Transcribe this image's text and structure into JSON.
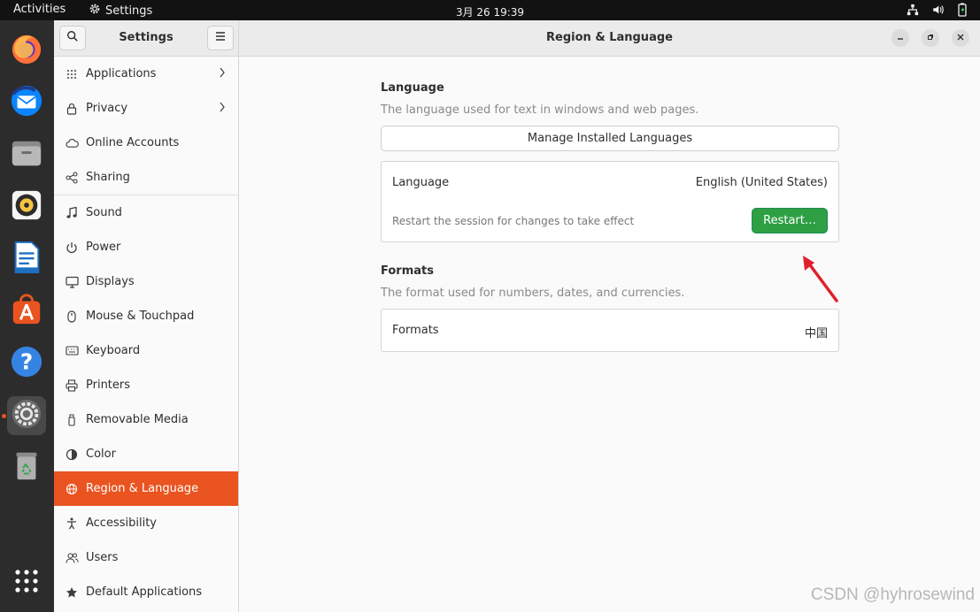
{
  "topbar": {
    "activities": "Activities",
    "app_name": "Settings",
    "clock": "3月 26  19:39"
  },
  "dock": {
    "items": [
      {
        "name": "firefox-icon"
      },
      {
        "name": "thunderbird-icon"
      },
      {
        "name": "files-icon"
      },
      {
        "name": "rhythmbox-icon"
      },
      {
        "name": "libreoffice-writer-icon"
      },
      {
        "name": "app-center-icon"
      },
      {
        "name": "help-icon"
      },
      {
        "name": "settings-icon",
        "active": true
      },
      {
        "name": "trash-icon"
      },
      {
        "name": "show-apps-icon"
      }
    ]
  },
  "sidebar": {
    "title": "Settings",
    "items": [
      {
        "label": "Applications",
        "icon": "apps-grid-icon",
        "chevron": true
      },
      {
        "label": "Privacy",
        "icon": "lock-icon",
        "chevron": true
      },
      {
        "label": "Online Accounts",
        "icon": "cloud-icon"
      },
      {
        "label": "Sharing",
        "icon": "share-icon"
      },
      {
        "label": "Sound",
        "icon": "music-note-icon"
      },
      {
        "label": "Power",
        "icon": "power-icon"
      },
      {
        "label": "Displays",
        "icon": "display-icon"
      },
      {
        "label": "Mouse & Touchpad",
        "icon": "mouse-icon"
      },
      {
        "label": "Keyboard",
        "icon": "keyboard-icon"
      },
      {
        "label": "Printers",
        "icon": "printer-icon"
      },
      {
        "label": "Removable Media",
        "icon": "usb-icon"
      },
      {
        "label": "Color",
        "icon": "color-icon"
      },
      {
        "label": "Region & Language",
        "icon": "globe-icon",
        "selected": true
      },
      {
        "label": "Accessibility",
        "icon": "accessibility-icon"
      },
      {
        "label": "Users",
        "icon": "users-icon"
      },
      {
        "label": "Default Applications",
        "icon": "star-icon"
      }
    ]
  },
  "main": {
    "title": "Region & Language",
    "language_section": {
      "title": "Language",
      "subtitle": "The language used for text in windows and web pages.",
      "manage_button": "Manage Installed Languages",
      "row_label": "Language",
      "row_value": "English (United States)",
      "restart_note": "Restart the session for changes to take effect",
      "restart_button": "Restart…"
    },
    "formats_section": {
      "title": "Formats",
      "subtitle": "The format used for numbers, dates, and currencies.",
      "row_label": "Formats",
      "row_value": "中国"
    }
  },
  "watermark": "CSDN @hyhrosewind",
  "colors": {
    "accent": "#e95420",
    "restart": "#2ea043",
    "annotation_arrow": "#e0202a"
  }
}
